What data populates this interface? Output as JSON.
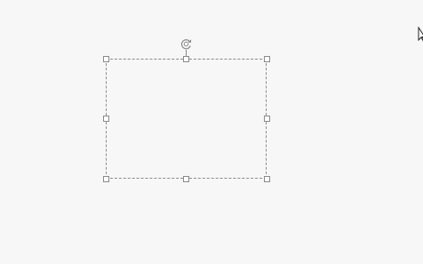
{
  "canvas": {
    "background": "#f7f7f7"
  },
  "selection": {
    "border_color": "#8a8a8a",
    "handle_fill": "#ffffff",
    "handles": [
      "top-left",
      "top-middle",
      "top-right",
      "middle-left",
      "middle-right",
      "bottom-left",
      "bottom-middle",
      "bottom-right"
    ],
    "rotate_icon": "rotate-handle-icon"
  },
  "cursor": {
    "icon": "mouse-pointer-icon"
  }
}
